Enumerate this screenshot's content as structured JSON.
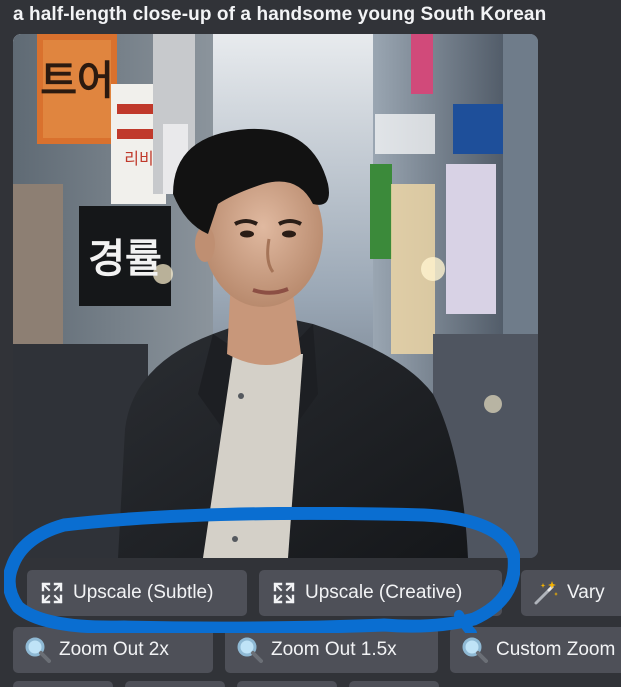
{
  "prompt": {
    "title": "a half-length close-up of a handsome young South Korean"
  },
  "image": {
    "description_icon": "photo",
    "signs": {
      "top_left": "트어",
      "middle_left": "경률",
      "right_column": "리비"
    }
  },
  "buttons": {
    "upscale_subtle": {
      "label": "Upscale (Subtle)",
      "icon": "expand-icon"
    },
    "upscale_creative": {
      "label": "Upscale (Creative)",
      "icon": "expand-icon"
    },
    "vary": {
      "label": "Vary",
      "icon": "magic-wand-icon"
    },
    "zoom_out_2x": {
      "label": "Zoom Out 2x",
      "icon": "magnifier-icon"
    },
    "zoom_out_1_5x": {
      "label": "Zoom Out 1.5x",
      "icon": "magnifier-icon"
    },
    "custom_zoom": {
      "label": "Custom Zoom",
      "icon": "magnifier-icon"
    }
  },
  "colors": {
    "background": "#313338",
    "button": "#4e5058",
    "text": "#f2f3f5",
    "highlight": "#0a6ed1"
  }
}
